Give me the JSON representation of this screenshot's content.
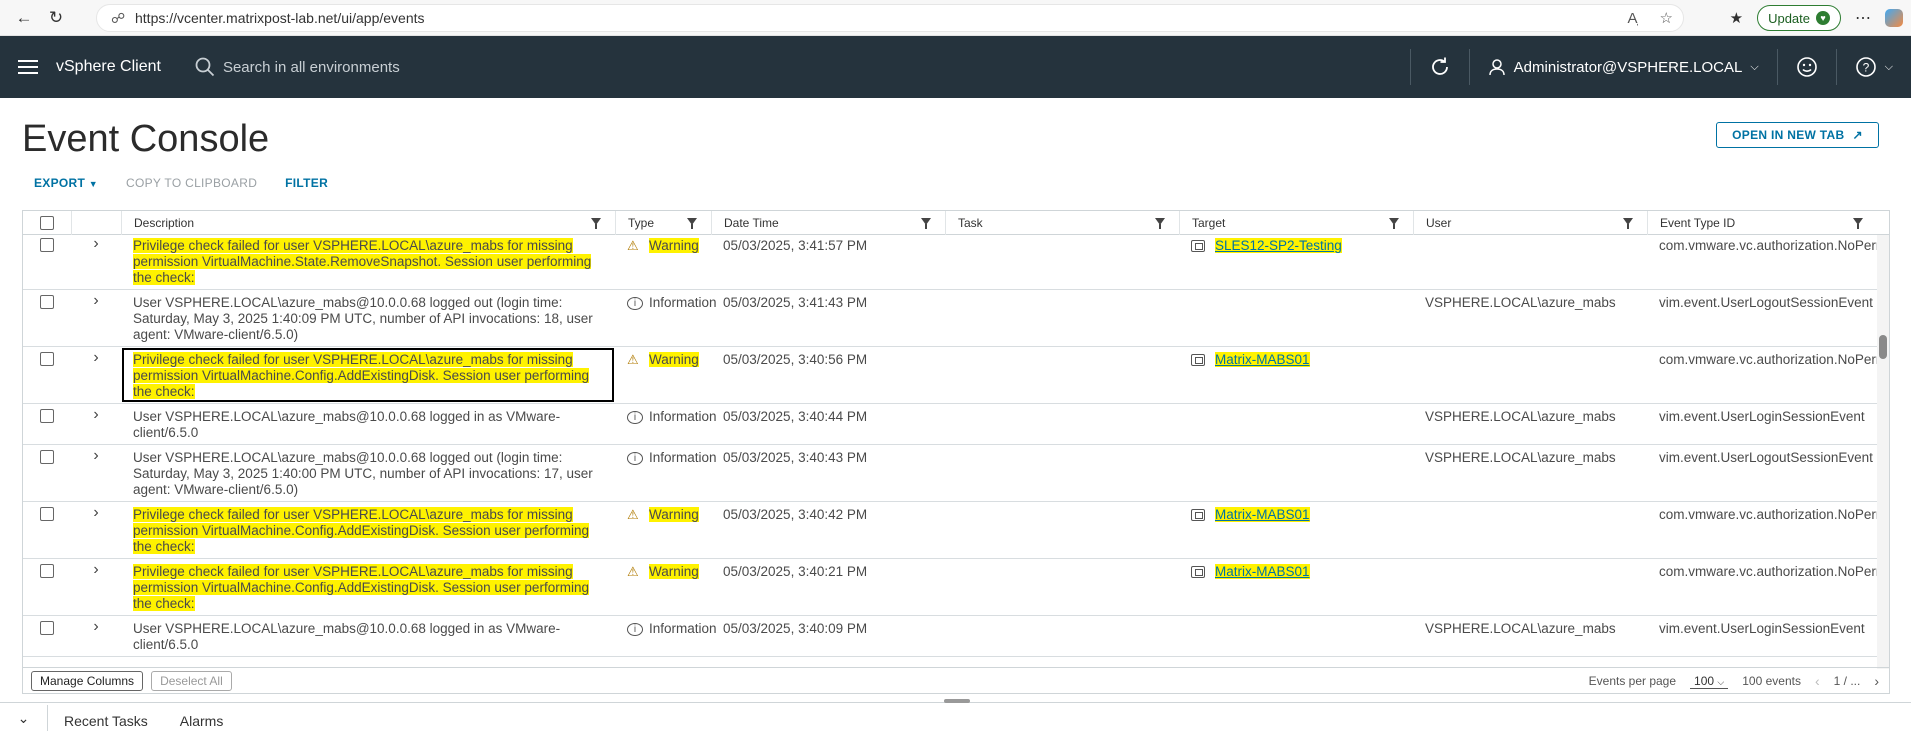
{
  "browser": {
    "url": "https://vcenter.matrixpost-lab.net/ui/app/events",
    "update_label": "Update"
  },
  "header": {
    "app_title": "vSphere Client",
    "search_placeholder": "Search in all environments",
    "user": "Administrator@VSPHERE.LOCAL"
  },
  "page": {
    "title": "Event Console",
    "open_new_tab": "OPEN IN NEW TAB"
  },
  "toolbar": {
    "export": "EXPORT",
    "copy": "COPY TO CLIPBOARD",
    "filter": "FILTER"
  },
  "columns": {
    "description": "Description",
    "type": "Type",
    "datetime": "Date Time",
    "task": "Task",
    "target": "Target",
    "user": "User",
    "event_type_id": "Event Type ID"
  },
  "rows": [
    {
      "desc": "Privilege check failed for user VSPHERE.LOCAL\\azure_mabs for missing permission VirtualMachine.State.RemoveSnapshot. Session user performing the check:",
      "type": "Warning",
      "datetime": "05/03/2025, 3:41:57 PM",
      "task": "",
      "target": "SLES12-SP2-Testing",
      "user": "",
      "event_type_id": "com.vmware.vc.authorization.NoPermission",
      "highlight": true,
      "selected": false
    },
    {
      "desc": "User VSPHERE.LOCAL\\azure_mabs@10.0.0.68 logged out (login time: Saturday, May 3, 2025 1:40:09 PM UTC, number of API invocations: 18, user agent: VMware-client/6.5.0)",
      "type": "Information",
      "datetime": "05/03/2025, 3:41:43 PM",
      "task": "",
      "target": "",
      "user": "VSPHERE.LOCAL\\azure_mabs",
      "event_type_id": "vim.event.UserLogoutSessionEvent",
      "highlight": false,
      "selected": false
    },
    {
      "desc": "Privilege check failed for user VSPHERE.LOCAL\\azure_mabs for missing permission VirtualMachine.Config.AddExistingDisk. Session user performing the check:",
      "type": "Warning",
      "datetime": "05/03/2025, 3:40:56 PM",
      "task": "",
      "target": "Matrix-MABS01",
      "user": "",
      "event_type_id": "com.vmware.vc.authorization.NoPermission",
      "highlight": true,
      "selected": true
    },
    {
      "desc": "User VSPHERE.LOCAL\\azure_mabs@10.0.0.68 logged in as VMware-client/6.5.0",
      "type": "Information",
      "datetime": "05/03/2025, 3:40:44 PM",
      "task": "",
      "target": "",
      "user": "VSPHERE.LOCAL\\azure_mabs",
      "event_type_id": "vim.event.UserLoginSessionEvent",
      "highlight": false,
      "selected": false
    },
    {
      "desc": "User VSPHERE.LOCAL\\azure_mabs@10.0.0.68 logged out (login time: Saturday, May 3, 2025 1:40:00 PM UTC, number of API invocations: 17, user agent: VMware-client/6.5.0)",
      "type": "Information",
      "datetime": "05/03/2025, 3:40:43 PM",
      "task": "",
      "target": "",
      "user": "VSPHERE.LOCAL\\azure_mabs",
      "event_type_id": "vim.event.UserLogoutSessionEvent",
      "highlight": false,
      "selected": false
    },
    {
      "desc": "Privilege check failed for user VSPHERE.LOCAL\\azure_mabs for missing permission VirtualMachine.Config.AddExistingDisk. Session user performing the check:",
      "type": "Warning",
      "datetime": "05/03/2025, 3:40:42 PM",
      "task": "",
      "target": "Matrix-MABS01",
      "user": "",
      "event_type_id": "com.vmware.vc.authorization.NoPermission",
      "highlight": true,
      "selected": false
    },
    {
      "desc": "Privilege check failed for user VSPHERE.LOCAL\\azure_mabs for missing permission VirtualMachine.Config.AddExistingDisk. Session user performing the check:",
      "type": "Warning",
      "datetime": "05/03/2025, 3:40:21 PM",
      "task": "",
      "target": "Matrix-MABS01",
      "user": "",
      "event_type_id": "com.vmware.vc.authorization.NoPermission",
      "highlight": true,
      "selected": false
    },
    {
      "desc": "User VSPHERE.LOCAL\\azure_mabs@10.0.0.68 logged in as VMware-client/6.5.0",
      "type": "Information",
      "datetime": "05/03/2025, 3:40:09 PM",
      "task": "",
      "target": "",
      "user": "VSPHERE.LOCAL\\azure_mabs",
      "event_type_id": "vim.event.UserLoginSessionEvent",
      "highlight": false,
      "selected": false
    }
  ],
  "footer": {
    "manage_columns": "Manage Columns",
    "deselect_all": "Deselect All",
    "events_per_page_label": "Events per page",
    "events_per_page": "100",
    "total": "100 events",
    "page_indicator": "1 / ..."
  },
  "bottom_panel": {
    "tabs": [
      "Recent Tasks",
      "Alarms"
    ]
  }
}
